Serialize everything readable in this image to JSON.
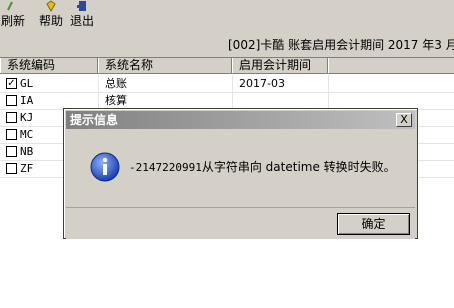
{
  "toolbar": {
    "items": [
      {
        "label": "刷新",
        "icon": "refresh-icon"
      },
      {
        "label": "帮助",
        "icon": "help-icon"
      },
      {
        "label": "退出",
        "icon": "exit-icon"
      }
    ]
  },
  "info": "[002]卡酷 账套启用会计期间 2017 年3 月",
  "grid": {
    "columns": [
      "系统编码",
      "系统名称",
      "启用会计期间"
    ],
    "rows": [
      {
        "code": "GL",
        "name": "总账",
        "period": "2017-03",
        "checked": true
      },
      {
        "code": "IA",
        "name": "核算",
        "period": "",
        "checked": false
      },
      {
        "code": "KJ",
        "name": "",
        "period": "",
        "checked": false
      },
      {
        "code": "MC",
        "name": "",
        "period": "",
        "checked": false
      },
      {
        "code": "NB",
        "name": "",
        "period": "",
        "checked": false
      },
      {
        "code": "ZF",
        "name": "",
        "period": "",
        "checked": false
      }
    ]
  },
  "dialog": {
    "title": "提示信息",
    "close_label": "X",
    "message_code": "-2147220991",
    "message_text": "从字符串向 datetime 转换时失败。",
    "ok_label": "确定",
    "icon": "info-icon"
  }
}
